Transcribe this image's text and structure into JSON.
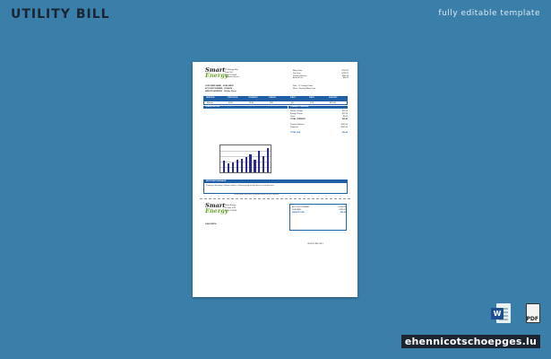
{
  "header": {
    "title": "UTILITY BILL",
    "subtitle": "fully editable template"
  },
  "bill": {
    "logo": [
      "Smart",
      "Energy"
    ],
    "company_lines": [
      "123 Energy Way",
      "Suite 100",
      "City, ST 00000",
      "Customer Service"
    ],
    "account_rows": [
      {
        "label": "CUSTOMER NAME",
        "value": "JOHN SMITH"
      },
      {
        "label": "ACCOUNT NUMBER",
        "value": "12345678"
      },
      {
        "label": "SERVICE ADDRESS",
        "value": "123 Any Street"
      }
    ],
    "summary_rows": [
      {
        "label": "Billing Date",
        "value": "07/14/21"
      },
      {
        "label": "Due Date",
        "value": "07/31/21"
      },
      {
        "label": "Previous Balance",
        "value": "$105.60"
      },
      {
        "label": "Amount Due",
        "value": "$96.45"
      }
    ],
    "meter_rows": [
      {
        "label": "Rate",
        "value": "C1 Cottage Power"
      },
      {
        "label": "Meter",
        "value": "Monthly Billing Cycle"
      }
    ],
    "columns": [
      "SERVICE",
      "PREVIOUS",
      "CURRENT",
      "USAGE",
      "DAYS",
      "RATE",
      "AMOUNT"
    ],
    "column_values": [
      "Electric",
      "4520",
      "5148",
      "628",
      "30",
      "0.12",
      "$75.36"
    ],
    "usage_heading": "USAGE HISTORY",
    "charges_heading": "CURRENT CHARGES",
    "charges": [
      {
        "label": "Service Charge",
        "value": "$12.00"
      },
      {
        "label": "Energy Charge",
        "value": "$75.36"
      },
      {
        "label": "Taxes",
        "value": "$9.09"
      },
      {
        "label": "TOTAL CURRENT",
        "value": "$96.45"
      },
      {
        "label": "Previous Balance",
        "value": "$105.60"
      },
      {
        "label": "Payments",
        "value": "-$105.60"
      },
      {
        "label": "TOTAL DUE",
        "value": "$96.45"
      }
    ],
    "chart_values": [
      0.45,
      0.35,
      0.4,
      0.5,
      0.55,
      0.6,
      0.7,
      0.5,
      0.85,
      0.65,
      0.95
    ],
    "notes_heading": "IMPORTANT MESSAGE",
    "notes_text": "Thank you for being a valued customer. Please pay by the due date to avoid late fees.",
    "footer_note": "Please detach and return the bottom portion with your payment.",
    "stub_rows": [
      {
        "label": "ACCOUNT NUMBER",
        "value": "12345678"
      },
      {
        "label": "DUE DATE",
        "value": "07/31/21"
      },
      {
        "label": "AMOUNT DUE",
        "value": "$96.45"
      }
    ],
    "stub_address": [
      "Smart Energy",
      "PO Box 1234",
      "City, ST 00000"
    ],
    "stub_customer": "JOHN SMITH",
    "stub_line": "OFFICE USE ONLY"
  },
  "icons": {
    "word_badge": "W",
    "pdf_label": "PDF"
  },
  "watermark": "ehennicotschoepges.lu"
}
